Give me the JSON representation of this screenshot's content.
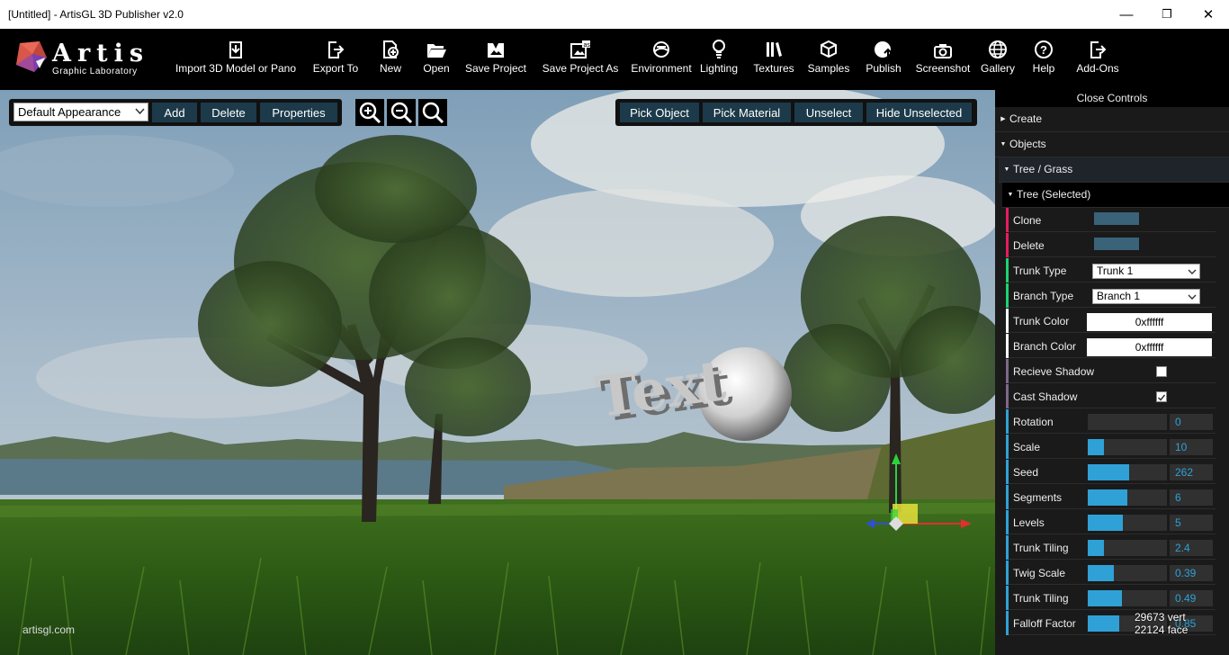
{
  "window": {
    "title": "[Untitled] - ArtisGL 3D Publisher v2.0",
    "minimize": "—",
    "maximize": "❐",
    "close": "✕"
  },
  "logo": {
    "title": "Artis",
    "subtitle": "Graphic Laboratory"
  },
  "toolbar": [
    {
      "label": "Import 3D Model or Pano",
      "icon": "import-icon"
    },
    {
      "label": "Export To",
      "icon": "export-icon"
    },
    {
      "label": "New",
      "icon": "new-file-icon"
    },
    {
      "label": "Open",
      "icon": "folder-open-icon"
    },
    {
      "label": "Save Project",
      "icon": "save-project-icon"
    },
    {
      "label": "Save Project As",
      "icon": "save-as-icon"
    },
    {
      "label": "Environment",
      "icon": "environment-icon"
    },
    {
      "label": "Lighting",
      "icon": "lightbulb-icon"
    },
    {
      "label": "Textures",
      "icon": "textures-icon"
    },
    {
      "label": "Samples",
      "icon": "cubes-icon"
    },
    {
      "label": "Publish",
      "icon": "globe-upload-icon"
    },
    {
      "label": "Screenshot",
      "icon": "camera-icon"
    },
    {
      "label": "Gallery",
      "icon": "globe-icon"
    },
    {
      "label": "Help",
      "icon": "help-icon"
    },
    {
      "label": "Add-Ons",
      "icon": "add-ons-icon"
    }
  ],
  "appearance": {
    "selected": "Default Appearance",
    "add": "Add",
    "delete": "Delete",
    "properties": "Properties"
  },
  "zoom": [
    "zoom-in-icon",
    "zoom-out-icon",
    "zoom-reset-icon"
  ],
  "pick": {
    "pick_object": "Pick Object",
    "pick_material": "Pick Material",
    "unselect": "Unselect",
    "hide_unselected": "Hide Unselected"
  },
  "scene": {
    "text_object": "Text"
  },
  "panel": {
    "close": "Close Controls",
    "create": "Create",
    "objects": "Objects",
    "tree_grass": "Tree / Grass",
    "tree_selected": "Tree (Selected)",
    "clone": "Clone",
    "delete": "Delete",
    "trunk_type": {
      "label": "Trunk Type",
      "value": "Trunk 1"
    },
    "branch_type": {
      "label": "Branch Type",
      "value": "Branch 1"
    },
    "trunk_color": {
      "label": "Trunk Color",
      "value": "0xffffff"
    },
    "branch_color": {
      "label": "Branch Color",
      "value": "0xffffff"
    },
    "recieve_shadow": {
      "label": "Recieve Shadow",
      "checked": false
    },
    "cast_shadow": {
      "label": "Cast Shadow",
      "checked": true
    },
    "sliders": [
      {
        "label": "Rotation",
        "value": "0",
        "fraction": 0.0
      },
      {
        "label": "Scale",
        "value": "10",
        "fraction": 0.2
      },
      {
        "label": "Seed",
        "value": "262",
        "fraction": 0.52
      },
      {
        "label": "Segments",
        "value": "6",
        "fraction": 0.5
      },
      {
        "label": "Levels",
        "value": "5",
        "fraction": 0.44
      },
      {
        "label": "Trunk Tiling",
        "value": "2.4",
        "fraction": 0.2
      },
      {
        "label": "Twig Scale",
        "value": "0.39",
        "fraction": 0.33
      },
      {
        "label": "Trunk Tiling",
        "value": "0.49",
        "fraction": 0.43
      },
      {
        "label": "Falloff Factor",
        "value": "0.85",
        "fraction": 0.4
      }
    ]
  },
  "footer": {
    "site": "artisgl.com"
  },
  "stats": {
    "vertices": "29673 vert",
    "faces": "22124 face"
  },
  "colors": {
    "accent": "#2fa1d6",
    "button": "#1c3a4a",
    "panel": "#1a1a1a"
  }
}
